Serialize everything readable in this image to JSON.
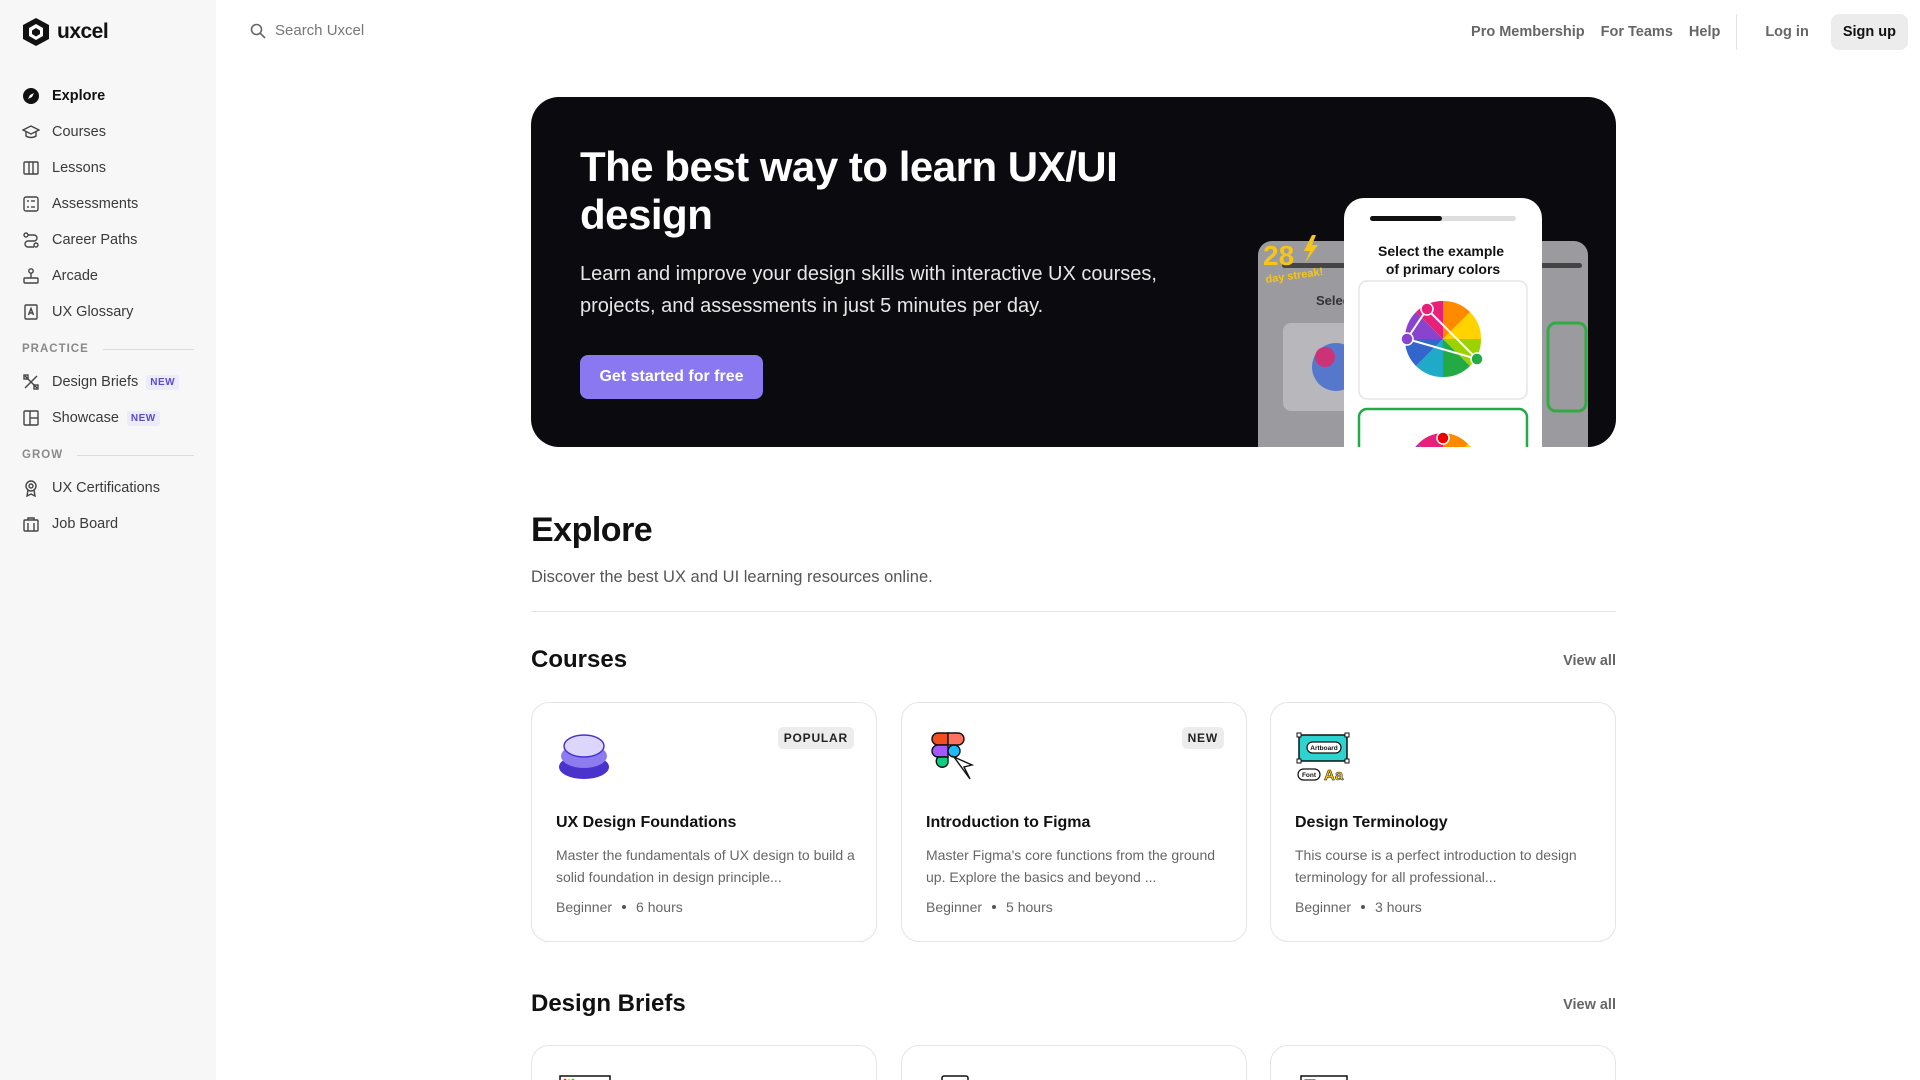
{
  "brand": {
    "name": "uxcel"
  },
  "sidebar": {
    "items": [
      {
        "label": "Explore",
        "icon": "compass-icon",
        "active": true
      },
      {
        "label": "Courses",
        "icon": "graduation-cap-icon"
      },
      {
        "label": "Lessons",
        "icon": "book-icon"
      },
      {
        "label": "Assessments",
        "icon": "checklist-icon"
      },
      {
        "label": "Career Paths",
        "icon": "path-icon"
      },
      {
        "label": "Arcade",
        "icon": "joystick-icon"
      },
      {
        "label": "UX Glossary",
        "icon": "glossary-icon"
      }
    ],
    "practice_label": "PRACTICE",
    "practice_items": [
      {
        "label": "Design Briefs",
        "badge": "NEW",
        "icon": "tools-icon"
      },
      {
        "label": "Showcase",
        "badge": "NEW",
        "icon": "layout-icon"
      }
    ],
    "grow_label": "GROW",
    "grow_items": [
      {
        "label": "UX Certifications",
        "icon": "certificate-icon"
      },
      {
        "label": "Job Board",
        "icon": "briefcase-icon"
      }
    ]
  },
  "search": {
    "placeholder": "Search Uxcel"
  },
  "topnav": {
    "pro": "Pro Membership",
    "teams": "For Teams",
    "help": "Help",
    "login": "Log in",
    "signup": "Sign up"
  },
  "hero": {
    "title": "The best way to learn UX/UI design",
    "subtitle": "Learn and improve your design skills with interactive UX courses, projects, and assessments in just 5 minutes per day.",
    "cta": "Get started for free",
    "streak_number": "28",
    "streak_label": "day streak!",
    "quiz_prompt": "Select the example of primary colors",
    "quiz_prompt_back": "Selec",
    "accent_color": "#8a78f0",
    "streak_color": "#f5c518"
  },
  "explore": {
    "title": "Explore",
    "subtitle": "Discover the best UX and UI learning resources online."
  },
  "courses": {
    "title": "Courses",
    "view_all": "View all",
    "items": [
      {
        "badge": "POPULAR",
        "title": "UX Design Foundations",
        "desc": "Master the fundamentals of UX design to build a solid foundation in design principle...",
        "level": "Beginner",
        "duration": "6 hours",
        "icon": "layers-stack-icon"
      },
      {
        "badge": "NEW",
        "title": "Introduction to Figma",
        "desc": "Master Figma's core functions from the ground up. Explore the basics and beyond ...",
        "level": "Beginner",
        "duration": "5 hours",
        "icon": "figma-logo-icon"
      },
      {
        "badge": "",
        "title": "Design Terminology",
        "desc": "This course is a perfect introduction to design terminology for all professional...",
        "level": "Beginner",
        "duration": "3 hours",
        "icon": "artboard-font-icon",
        "icon_text_1": "Artboard",
        "icon_text_2": "Font",
        "icon_text_3": "Aa"
      }
    ]
  },
  "design_briefs": {
    "title": "Design Briefs",
    "view_all": "View all"
  }
}
